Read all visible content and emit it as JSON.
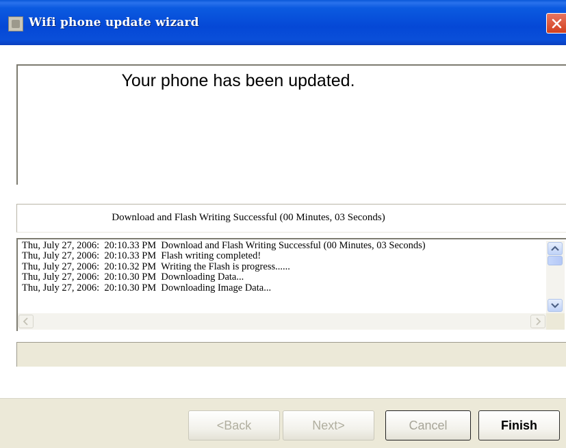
{
  "window": {
    "title": "Wifi phone update wizard"
  },
  "message": "Your phone has been updated.",
  "status": "Download and Flash Writing Successful (00 Minutes, 03 Seconds)",
  "log": [
    "Thu, July 27, 2006:  20:10.33 PM  Download and Flash Writing Successful (00 Minutes, 03 Seconds)",
    "Thu, July 27, 2006:  20:10.33 PM  Flash writing completed!",
    "Thu, July 27, 2006:  20:10.32 PM  Writing the Flash is progress......",
    "Thu, July 27, 2006:  20:10.30 PM  Downloading Data...",
    "Thu, July 27, 2006:  20:10.30 PM  Downloading Image Data..."
  ],
  "buttons": {
    "back": "<Back",
    "next": "Next>",
    "cancel": "Cancel",
    "finish": "Finish"
  },
  "colors": {
    "titlebar": "#0548d6",
    "close": "#d2401e",
    "dialog_face": "#ece9d8"
  }
}
